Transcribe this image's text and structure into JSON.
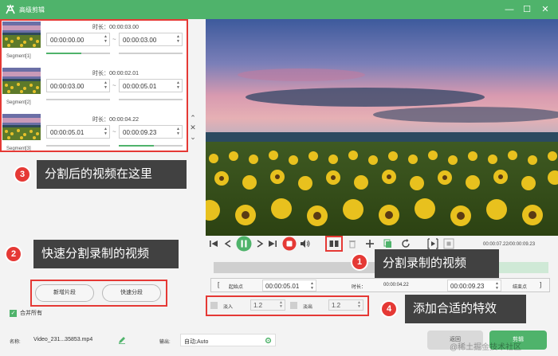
{
  "window": {
    "title": "高级剪辑",
    "minimize": "—",
    "maximize": "☐",
    "close": "✕"
  },
  "segments": [
    {
      "label": "Segment[1]",
      "duration_label": "时长：",
      "duration": "00:00:03.00",
      "start": "00:00:00.00",
      "end": "00:00:03.00",
      "fill_fraction": 0.55
    },
    {
      "label": "Segment[2]",
      "duration_label": "时长：",
      "duration": "00:00:02.01",
      "start": "00:00:03.00",
      "end": "00:00:05.01",
      "fill_fraction": 0.55
    },
    {
      "label": "Segment[3]",
      "duration_label": "时长：",
      "duration": "00:00:04.22",
      "start": "00:00:05.01",
      "end": "00:00:09.23",
      "fill_fraction": 0.55
    }
  ],
  "range_separator": "~",
  "scroll_arrows": {
    "up": "⌃",
    "close": "✕",
    "down": "⌄"
  },
  "callouts": {
    "c1": {
      "badge": "1",
      "text": "分割录制的视频"
    },
    "c2": {
      "badge": "2",
      "text": "快速分割录制的视频"
    },
    "c3": {
      "badge": "3",
      "text": "分割后的视频在这里"
    },
    "c4": {
      "badge": "4",
      "text": "添加合适的特效"
    }
  },
  "left_actions": {
    "add_segment": "新增片段",
    "quick_split": "快速分段"
  },
  "merge_all": {
    "label": "合并所有",
    "checked": true
  },
  "player": {
    "timestamp": "00:00:07.22/00:00:09.23"
  },
  "range": {
    "open_bracket": "[",
    "start_label": "起始点",
    "start_value": "00:00:05.01",
    "duration_label": "时长：",
    "duration_value": "00:00:04.22",
    "end_value": "00:00:09.23",
    "end_label": "结束点",
    "close_bracket": "]"
  },
  "effects": {
    "fade_in_label": "淡入",
    "fade_in_value": "1.2",
    "fade_out_label": "淡出",
    "fade_out_value": "1.2"
  },
  "bottom": {
    "name_label": "名称:",
    "name_value": "Video_231...35853.mp4",
    "output_label": "输出:",
    "output_value": "自动;Auto",
    "back_button": "返回",
    "cut_button": "剪辑"
  },
  "watermark": "@稀土掘金技术社区",
  "colors": {
    "accent": "#4fb36b",
    "highlight": "#e53935",
    "callout_bg": "#414141"
  }
}
